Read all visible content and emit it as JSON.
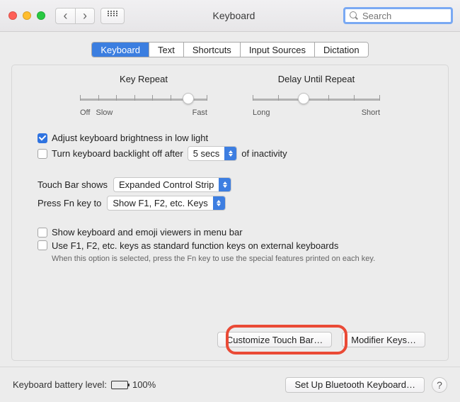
{
  "window": {
    "title": "Keyboard",
    "search_placeholder": "Search"
  },
  "tabs": {
    "keyboard": "Keyboard",
    "text": "Text",
    "shortcuts": "Shortcuts",
    "input_sources": "Input Sources",
    "dictation": "Dictation"
  },
  "sliders": {
    "key_repeat": {
      "label": "Key Repeat",
      "left_end": "Off",
      "left_end2": "Slow",
      "right_end": "Fast"
    },
    "delay": {
      "label": "Delay Until Repeat",
      "left_end": "Long",
      "right_end": "Short"
    }
  },
  "options": {
    "adjust_brightness": "Adjust keyboard brightness in low light",
    "backlight_off": "Turn keyboard backlight off after",
    "backlight_off_value": "5 secs",
    "inactivity_suffix": "of inactivity",
    "touchbar_label": "Touch Bar shows",
    "touchbar_value": "Expanded Control Strip",
    "fn_label": "Press Fn key to",
    "fn_value": "Show F1, F2, etc. Keys",
    "show_viewers": "Show keyboard and emoji viewers in menu bar",
    "use_f_keys": "Use F1, F2, etc. keys as standard function keys on external keyboards",
    "use_f_keys_help": "When this option is selected, press the Fn key to use the special features printed on each key."
  },
  "buttons": {
    "customize_touchbar": "Customize Touch Bar…",
    "modifier_keys": "Modifier Keys…",
    "setup_bluetooth": "Set Up Bluetooth Keyboard…"
  },
  "footer": {
    "battery_label": "Keyboard battery level:",
    "battery_pct": "100%",
    "help": "?"
  }
}
